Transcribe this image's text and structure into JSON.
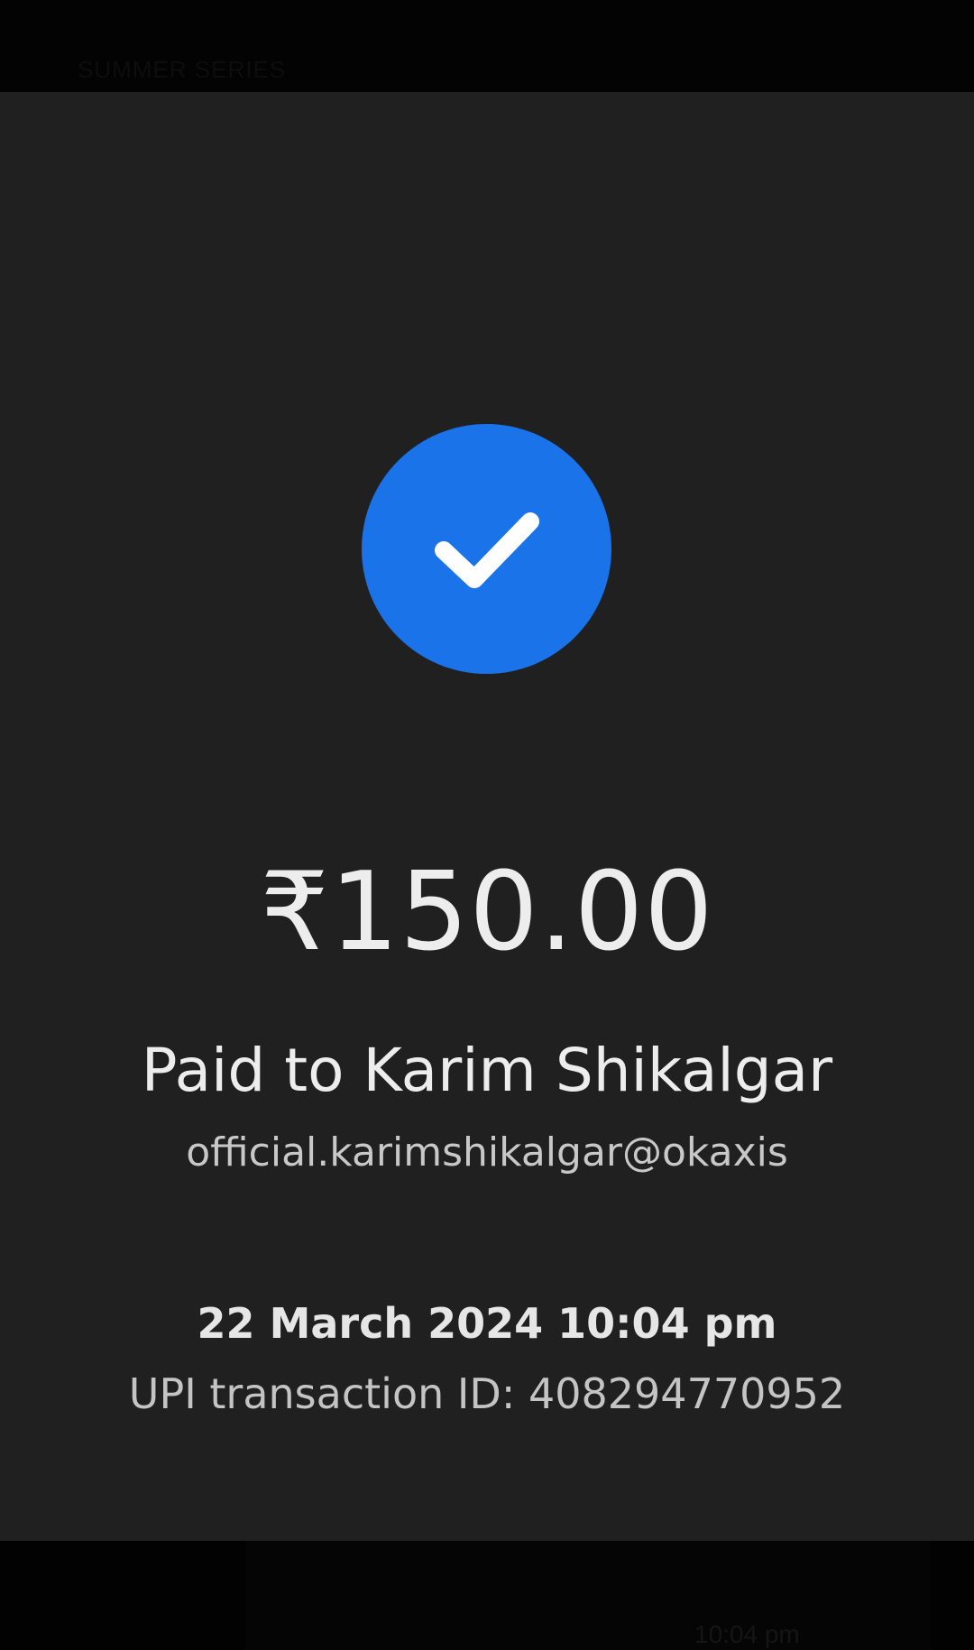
{
  "background_text": "SUMMER SERIES",
  "payment": {
    "amount": "₹150.00",
    "payee": "Paid to Karim Shikalgar",
    "upi_id": "official.karimshikalgar@okaxis",
    "datetime": "22 March 2024 10:04 pm",
    "transaction_id": "UPI transaction ID: 408294770952"
  },
  "status_icon": "check-icon",
  "background_time": "10:04 pm",
  "colors": {
    "card_background": "#202020",
    "success_circle": "#1a73e8",
    "text_primary": "#ededed",
    "text_secondary": "#c4c4c4"
  }
}
